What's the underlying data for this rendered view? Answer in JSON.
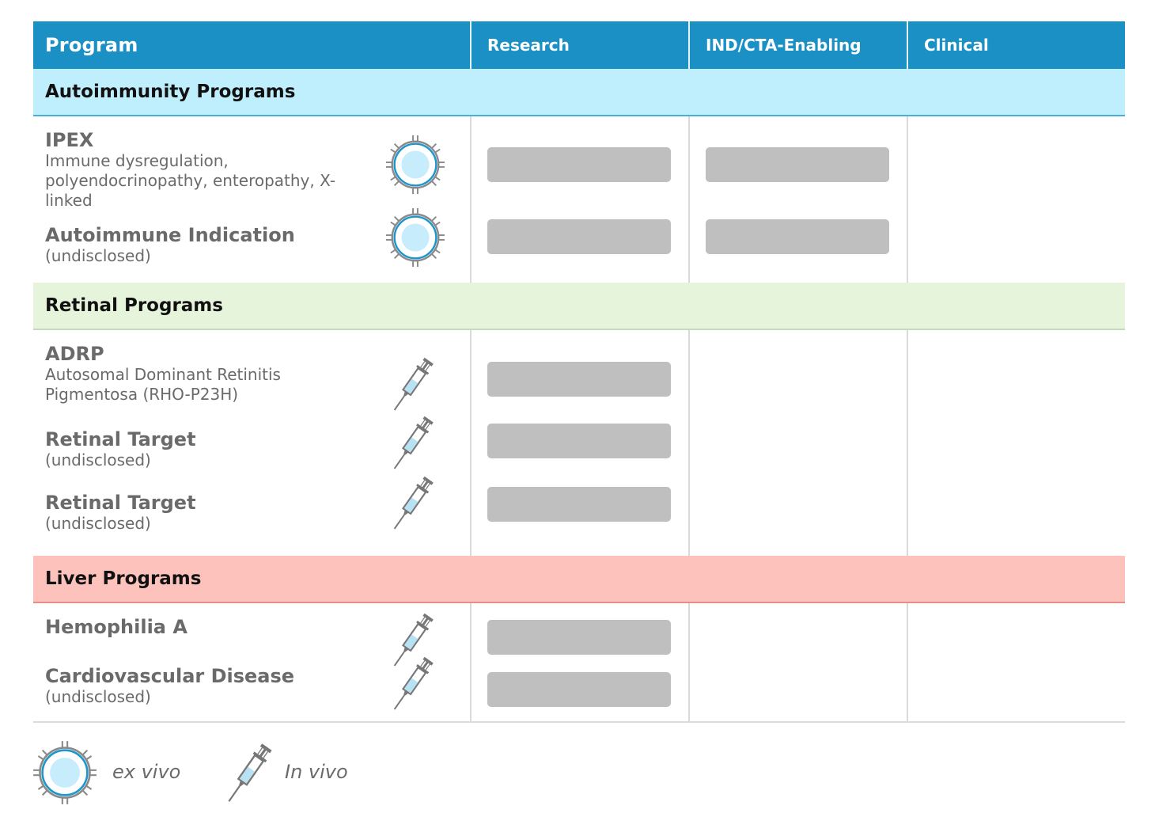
{
  "header": {
    "columns": [
      "Program",
      "Research",
      "IND/CTA-Enabling",
      "Clinical"
    ],
    "color": "#1a90c4"
  },
  "sections": [
    {
      "title": "Autoimmunity Programs",
      "color": "#bfeefd",
      "programs": [
        {
          "name": "IPEX",
          "description": "Immune dysregulation, polyendocrinopathy, enteropathy, X-linked",
          "modality": "ex vivo",
          "stages_completed": [
            "Research",
            "IND/CTA-Enabling"
          ]
        },
        {
          "name": "Autoimmune Indication",
          "description": "(undisclosed)",
          "modality": "ex vivo",
          "stages_completed": [
            "Research",
            "IND/CTA-Enabling"
          ]
        }
      ]
    },
    {
      "title": "Retinal Programs",
      "color": "#e6f4dc",
      "programs": [
        {
          "name": "ADRP",
          "description": "Autosomal Dominant Retinitis Pigmentosa (RHO-P23H)",
          "modality": "In vivo",
          "stages_completed": [
            "Research"
          ]
        },
        {
          "name": "Retinal Target",
          "description": "(undisclosed)",
          "modality": "In vivo",
          "stages_completed": [
            "Research"
          ]
        },
        {
          "name": "Retinal Target",
          "description": "(undisclosed)",
          "modality": "In vivo",
          "stages_completed": [
            "Research"
          ]
        }
      ]
    },
    {
      "title": "Liver Programs",
      "color": "#fcc2bb",
      "programs": [
        {
          "name": "Hemophilia A",
          "description": "",
          "modality": "In vivo",
          "stages_completed": [
            "Research"
          ]
        },
        {
          "name": "Cardiovascular Disease",
          "description": "(undisclosed)",
          "modality": "In vivo",
          "stages_completed": [
            "Research"
          ]
        }
      ]
    }
  ],
  "legend": {
    "ex_vivo_label": "ex vivo",
    "in_vivo_label": "In vivo"
  },
  "progress_bar_color": "#bfbfbf"
}
